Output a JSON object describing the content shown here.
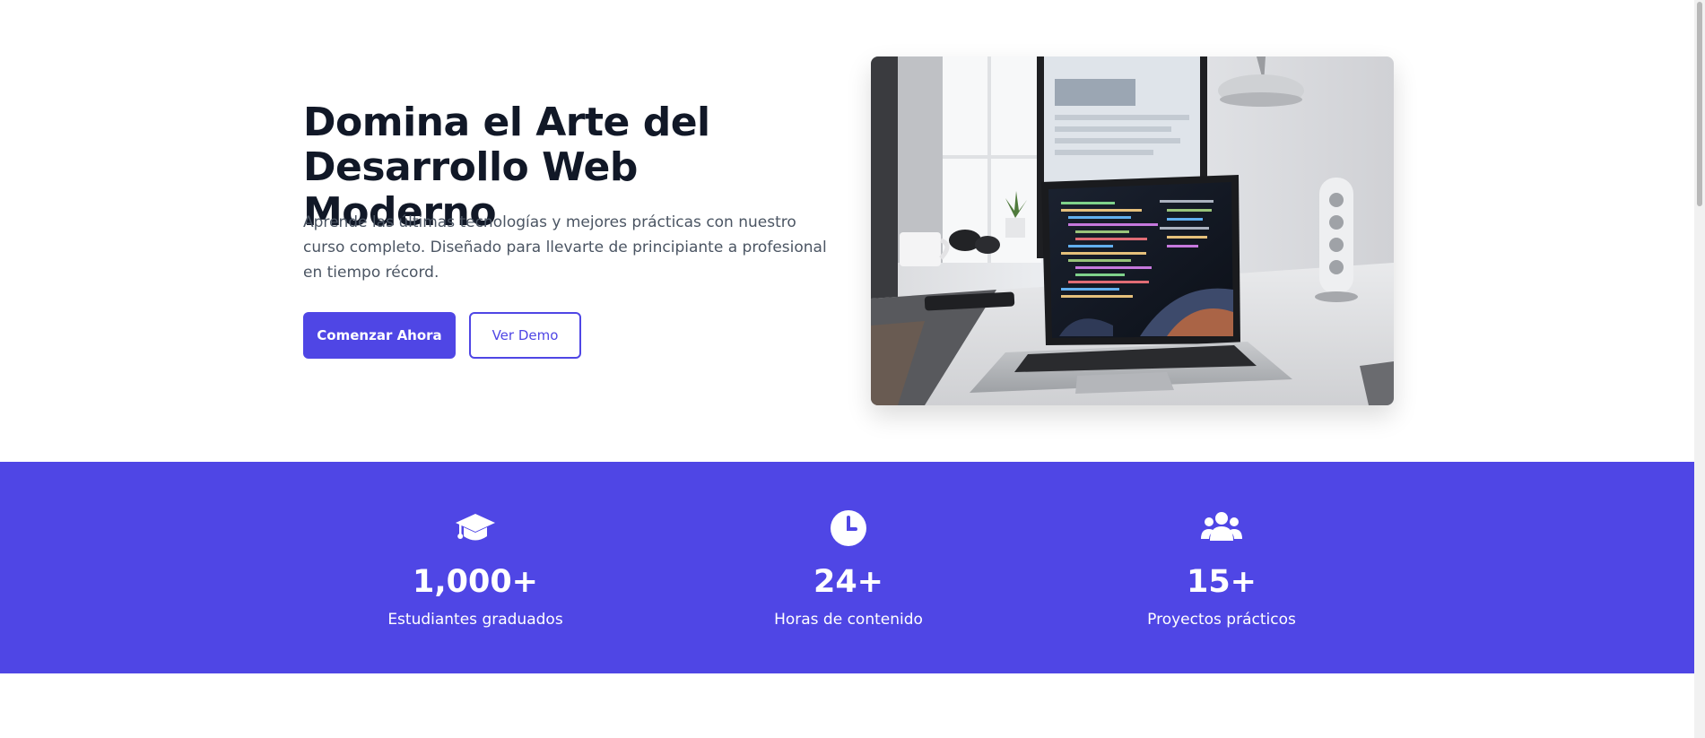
{
  "hero": {
    "title": "Domina el Arte del Desarrollo Web Moderno",
    "description": "Aprende las últimas tecnologías y mejores prácticas con nuestro curso completo. Diseñado para llevarte de principiante a profesional en tiempo récord.",
    "primary_button": "Comenzar Ahora",
    "secondary_button": "Ver Demo",
    "image_icon": "laptop-workspace-photo"
  },
  "stats": [
    {
      "icon": "graduation-cap-icon",
      "value": "1,000+",
      "label": "Estudiantes graduados"
    },
    {
      "icon": "clock-icon",
      "value": "24+",
      "label": "Horas de contenido"
    },
    {
      "icon": "users-icon",
      "value": "15+",
      "label": "Proyectos prácticos"
    }
  ],
  "colors": {
    "accent": "#4f46e5",
    "heading": "#111827",
    "body_text": "#4b5563",
    "background": "#ffffff"
  }
}
